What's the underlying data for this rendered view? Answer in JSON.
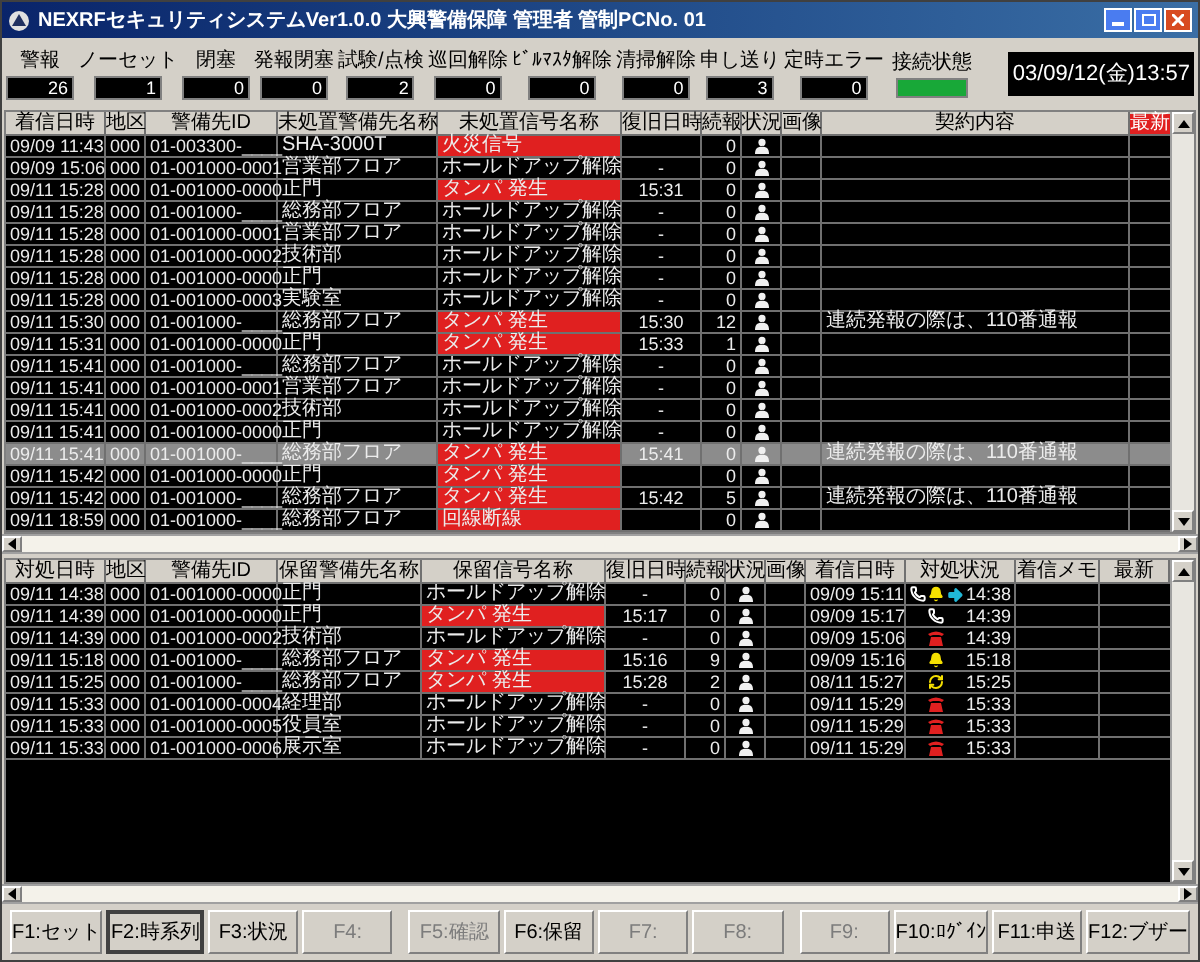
{
  "window": {
    "title": "NEXRFセキュリティシステムVer1.0.0 大興警備保障 管理者 管制PCNo. 01"
  },
  "counters": [
    {
      "label": "警報",
      "value": "26"
    },
    {
      "label": "ノーセット",
      "value": "1"
    },
    {
      "label": "閉塞",
      "value": "0"
    },
    {
      "label": "発報閉塞",
      "value": "0"
    },
    {
      "label": "試験/点検",
      "value": "2"
    },
    {
      "label": "巡回解除",
      "value": "0"
    },
    {
      "label": "ﾋﾞﾙﾏｽﾀ解除",
      "value": "0"
    },
    {
      "label": "清掃解除",
      "value": "0"
    },
    {
      "label": "申し送り",
      "value": "3"
    },
    {
      "label": "定時エラー",
      "value": "0"
    }
  ],
  "connection": {
    "label": "接続状態",
    "connected": true
  },
  "clock": "03/09/12(金)13:57",
  "top_table": {
    "columns": [
      "着信日時",
      "地区",
      "警備先ID",
      "未処置警備先名称",
      "未処置信号名称",
      "復旧日時",
      "続報",
      "状況",
      "画像",
      "契約内容"
    ],
    "badge": "最新",
    "rows": [
      {
        "time": "09/09 11:43",
        "area": "000",
        "id": "01-003300-____",
        "name": "SHA-3000T",
        "signal": "火災信号",
        "alert": true,
        "count": "0",
        "selected": false
      },
      {
        "time": "09/09 15:06",
        "area": "000",
        "id": "01-001000-0001",
        "name": "営業部フロア",
        "signal": "ホールドアップ解除",
        "alert": false,
        "recovery": "-",
        "count": "0",
        "selected": false
      },
      {
        "time": "09/11 15:28",
        "area": "000",
        "id": "01-001000-0000",
        "name": "正門",
        "signal": "タンパ 発生",
        "alert": true,
        "recovery": "15:31",
        "count": "0",
        "selected": false
      },
      {
        "time": "09/11 15:28",
        "area": "000",
        "id": "01-001000-____",
        "name": "総務部フロア",
        "signal": "ホールドアップ解除",
        "alert": false,
        "recovery": "-",
        "count": "0",
        "selected": false
      },
      {
        "time": "09/11 15:28",
        "area": "000",
        "id": "01-001000-0001",
        "name": "営業部フロア",
        "signal": "ホールドアップ解除",
        "alert": false,
        "recovery": "-",
        "count": "0",
        "selected": false
      },
      {
        "time": "09/11 15:28",
        "area": "000",
        "id": "01-001000-0002",
        "name": "技術部",
        "signal": "ホールドアップ解除",
        "alert": false,
        "recovery": "-",
        "count": "0",
        "selected": false
      },
      {
        "time": "09/11 15:28",
        "area": "000",
        "id": "01-001000-0000",
        "name": "正門",
        "signal": "ホールドアップ解除",
        "alert": false,
        "recovery": "-",
        "count": "0",
        "selected": false
      },
      {
        "time": "09/11 15:28",
        "area": "000",
        "id": "01-001000-0003",
        "name": "実験室",
        "signal": "ホールドアップ解除",
        "alert": false,
        "recovery": "-",
        "count": "0",
        "selected": false
      },
      {
        "time": "09/11 15:30",
        "area": "000",
        "id": "01-001000-____",
        "name": "総務部フロア",
        "signal": "タンパ 発生",
        "alert": true,
        "recovery": "15:30",
        "count": "12",
        "contract": "連続発報の際は、110番通報",
        "selected": false
      },
      {
        "time": "09/11 15:31",
        "area": "000",
        "id": "01-001000-0000",
        "name": "正門",
        "signal": "タンパ 発生",
        "alert": true,
        "recovery": "15:33",
        "count": "1",
        "selected": false
      },
      {
        "time": "09/11 15:41",
        "area": "000",
        "id": "01-001000-____",
        "name": "総務部フロア",
        "signal": "ホールドアップ解除",
        "alert": false,
        "recovery": "-",
        "count": "0",
        "selected": false
      },
      {
        "time": "09/11 15:41",
        "area": "000",
        "id": "01-001000-0001",
        "name": "営業部フロア",
        "signal": "ホールドアップ解除",
        "alert": false,
        "recovery": "-",
        "count": "0",
        "selected": false
      },
      {
        "time": "09/11 15:41",
        "area": "000",
        "id": "01-001000-0002",
        "name": "技術部",
        "signal": "ホールドアップ解除",
        "alert": false,
        "recovery": "-",
        "count": "0",
        "selected": false
      },
      {
        "time": "09/11 15:41",
        "area": "000",
        "id": "01-001000-0000",
        "name": "正門",
        "signal": "ホールドアップ解除",
        "alert": false,
        "recovery": "-",
        "count": "0",
        "selected": false
      },
      {
        "time": "09/11 15:41",
        "area": "000",
        "id": "01-001000-____",
        "name": "総務部フロア",
        "signal": "タンパ 発生",
        "alert": true,
        "recovery": "15:41",
        "count": "0",
        "contract": "連続発報の際は、110番通報",
        "selected": true
      },
      {
        "time": "09/11 15:42",
        "area": "000",
        "id": "01-001000-0000",
        "name": "正門",
        "signal": "タンパ 発生",
        "alert": true,
        "count": "0",
        "selected": false
      },
      {
        "time": "09/11 15:42",
        "area": "000",
        "id": "01-001000-____",
        "name": "総務部フロア",
        "signal": "タンパ 発生",
        "alert": true,
        "recovery": "15:42",
        "count": "5",
        "contract": "連続発報の際は、110番通報",
        "selected": false
      },
      {
        "time": "09/11 18:59",
        "area": "000",
        "id": "01-001000-____",
        "name": "総務部フロア",
        "signal": "回線断線",
        "alert": true,
        "count": "0",
        "selected": false
      }
    ]
  },
  "bottom_table": {
    "columns": [
      "対処日時",
      "地区",
      "警備先ID",
      "保留警備先名称",
      "保留信号名称",
      "復旧日時",
      "続報",
      "状況",
      "画像",
      "着信日時",
      "対処状況",
      "着信メモ",
      "最新"
    ],
    "rows": [
      {
        "time": "09/11 14:38",
        "area": "000",
        "id": "01-001000-0000",
        "name": "正門",
        "signal": "ホールドアップ解除",
        "alert": false,
        "recovery": "-",
        "count": "0",
        "received": "09/09 15:11",
        "icons": [
          {
            "kind": "handset"
          },
          {
            "kind": "bell"
          },
          {
            "kind": "arrow"
          }
        ],
        "handled": "14:38"
      },
      {
        "time": "09/11 14:39",
        "area": "000",
        "id": "01-001000-0000",
        "name": "正門",
        "signal": "タンパ 発生",
        "alert": true,
        "recovery": "15:17",
        "count": "0",
        "received": "09/09 15:17",
        "icons": [
          {
            "kind": "handset"
          }
        ],
        "handled": "14:39"
      },
      {
        "time": "09/11 14:39",
        "area": "000",
        "id": "01-001000-0002",
        "name": "技術部",
        "signal": "ホールドアップ解除",
        "alert": false,
        "recovery": "-",
        "count": "0",
        "received": "09/09 15:06",
        "icons": [
          {
            "kind": "telephone"
          }
        ],
        "handled": "14:39"
      },
      {
        "time": "09/11 15:18",
        "area": "000",
        "id": "01-001000-____",
        "name": "総務部フロア",
        "signal": "タンパ 発生",
        "alert": true,
        "recovery": "15:16",
        "count": "9",
        "received": "09/09 15:16",
        "icons": [
          {
            "kind": "bell"
          }
        ],
        "handled": "15:18"
      },
      {
        "time": "09/11 15:25",
        "area": "000",
        "id": "01-001000-____",
        "name": "総務部フロア",
        "signal": "タンパ 発生",
        "alert": true,
        "recovery": "15:28",
        "count": "2",
        "received": "08/11 15:27",
        "icons": [
          {
            "kind": "ring"
          }
        ],
        "handled": "15:25"
      },
      {
        "time": "09/11 15:33",
        "area": "000",
        "id": "01-001000-0004",
        "name": "経理部",
        "signal": "ホールドアップ解除",
        "alert": false,
        "recovery": "-",
        "count": "0",
        "received": "09/11 15:29",
        "icons": [
          {
            "kind": "telephone"
          }
        ],
        "handled": "15:33"
      },
      {
        "time": "09/11 15:33",
        "area": "000",
        "id": "01-001000-0005",
        "name": "役員室",
        "signal": "ホールドアップ解除",
        "alert": false,
        "recovery": "-",
        "count": "0",
        "received": "09/11 15:29",
        "icons": [
          {
            "kind": "telephone"
          }
        ],
        "handled": "15:33"
      },
      {
        "time": "09/11 15:33",
        "area": "000",
        "id": "01-001000-0006",
        "name": "展示室",
        "signal": "ホールドアップ解除",
        "alert": false,
        "recovery": "-",
        "count": "0",
        "received": "09/11 15:29",
        "icons": [
          {
            "kind": "telephone"
          }
        ],
        "handled": "15:33"
      }
    ]
  },
  "function_keys": [
    {
      "label": "F1:セット",
      "selected": false,
      "disabled": false
    },
    {
      "label": "F2:時系列",
      "selected": true,
      "disabled": false
    },
    {
      "label": "F3:状況",
      "selected": false,
      "disabled": false
    },
    {
      "label": "F4:",
      "selected": false,
      "disabled": true
    },
    {
      "label": "F5:確認",
      "selected": false,
      "disabled": true
    },
    {
      "label": "F6:保留",
      "selected": false,
      "disabled": false
    },
    {
      "label": "F7:",
      "selected": false,
      "disabled": true
    },
    {
      "label": "F8:",
      "selected": false,
      "disabled": true
    },
    {
      "label": "F9:",
      "selected": false,
      "disabled": true
    },
    {
      "label": "F10:ﾛｸﾞｲﾝ",
      "selected": false,
      "disabled": false
    },
    {
      "label": "F11:申送",
      "selected": false,
      "disabled": false
    },
    {
      "label": "F12:ブザー",
      "selected": false,
      "disabled": false
    }
  ]
}
